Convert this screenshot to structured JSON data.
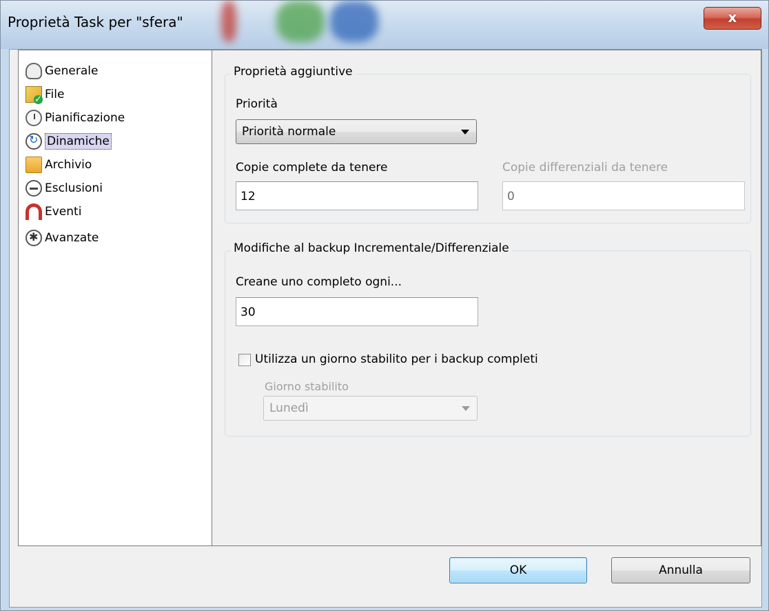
{
  "window": {
    "title": "Proprietà Task per \"sfera\"",
    "close_glyph": "x"
  },
  "nav": {
    "items": [
      {
        "label": "Generale",
        "icon": "user-icon"
      },
      {
        "label": "File",
        "icon": "file-check-icon"
      },
      {
        "label": "Pianificazione",
        "icon": "clock-icon"
      },
      {
        "label": "Dinamiche",
        "icon": "refresh-icon",
        "selected": true
      },
      {
        "label": "Archivio",
        "icon": "folder-icon"
      },
      {
        "label": "Esclusioni",
        "icon": "exclude-icon"
      },
      {
        "label": "Eventi",
        "icon": "magnet-icon"
      },
      {
        "label": "Avanzate",
        "icon": "gear-icon"
      }
    ]
  },
  "extra_props": {
    "legend": "Proprietà aggiuntive",
    "priority_label": "Priorità",
    "priority_value": "Priorità normale",
    "full_copies_label": "Copie complete da tenere",
    "full_copies_value": "12",
    "diff_copies_label": "Copie differenziali da tenere",
    "diff_copies_value": "0"
  },
  "incremental": {
    "legend": "Modifiche al backup Incrementale/Differenziale",
    "full_every_label": "Creane uno completo ogni...",
    "full_every_value": "30",
    "fixed_day_checkbox_label": "Utilizza un giorno stabilito per i backup completi",
    "fixed_day_checked": false,
    "fixed_day_label": "Giorno stabilito",
    "fixed_day_value": "Lunedì"
  },
  "footer": {
    "ok_label": "OK",
    "cancel_label": "Annulla"
  }
}
